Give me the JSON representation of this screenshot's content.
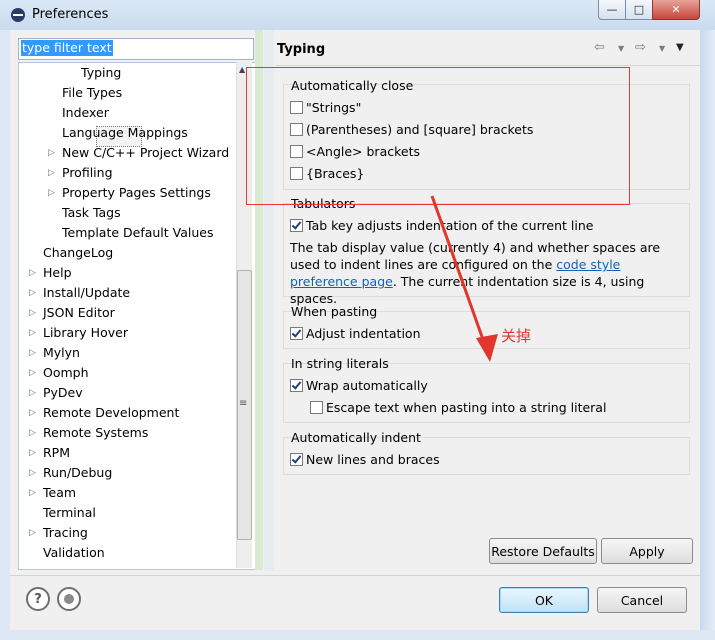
{
  "window": {
    "title": "Preferences",
    "min_glyph": "—",
    "max_glyph": "□",
    "close_glyph": "✕"
  },
  "filter": {
    "text": "type filter text"
  },
  "tree": {
    "items": [
      {
        "label": "Typing",
        "expandable": false,
        "selected": true
      },
      {
        "label": "File Types",
        "expandable": false
      },
      {
        "label": "Indexer",
        "expandable": false
      },
      {
        "label": "Language Mappings",
        "expandable": false
      },
      {
        "label": "New C/C++ Project Wizard",
        "expandable": true
      },
      {
        "label": "Profiling",
        "expandable": true
      },
      {
        "label": "Property Pages Settings",
        "expandable": true
      },
      {
        "label": "Task Tags",
        "expandable": false
      },
      {
        "label": "Template Default Values",
        "expandable": false
      },
      {
        "label": "ChangeLog",
        "expandable": false
      },
      {
        "label": "Help",
        "expandable": true
      },
      {
        "label": "Install/Update",
        "expandable": true
      },
      {
        "label": "JSON Editor",
        "expandable": true
      },
      {
        "label": "Library Hover",
        "expandable": true
      },
      {
        "label": "Mylyn",
        "expandable": true
      },
      {
        "label": "Oomph",
        "expandable": true
      },
      {
        "label": "PyDev",
        "expandable": true
      },
      {
        "label": "Remote Development",
        "expandable": true
      },
      {
        "label": "Remote Systems",
        "expandable": true
      },
      {
        "label": "RPM",
        "expandable": true
      },
      {
        "label": "Run/Debug",
        "expandable": true
      },
      {
        "label": "Team",
        "expandable": true
      },
      {
        "label": "Terminal",
        "expandable": false
      },
      {
        "label": "Tracing",
        "expandable": true
      },
      {
        "label": "Validation",
        "expandable": false
      }
    ]
  },
  "page": {
    "title": "Typing",
    "nav": {
      "back_icon": "⇦",
      "forward_icon": "⇨",
      "menu_icon": "▼"
    },
    "automatically_close": {
      "label": "Automatically close",
      "options": [
        {
          "label": "\"Strings\"",
          "checked": false
        },
        {
          "label": "(Parentheses) and [square] brackets",
          "checked": false
        },
        {
          "label": "<Angle> brackets",
          "checked": false
        },
        {
          "label": "{Braces}",
          "checked": false
        }
      ]
    },
    "tabulators": {
      "label": "Tabulators",
      "option": {
        "label": "Tab key adjusts indentation of the current line",
        "checked": true
      },
      "desc_before": "The tab display value (currently 4) and whether spaces are used to indent lines are configured on the ",
      "desc_link": "code style preference page",
      "desc_after": ". The current indentation size is 4, using spaces."
    },
    "when_pasting": {
      "label": "When pasting",
      "option": {
        "label": "Adjust indentation",
        "checked": true
      }
    },
    "string_literals": {
      "label": "In string literals",
      "wrap": {
        "label": "Wrap automatically",
        "checked": true
      },
      "escape": {
        "label": "Escape text when pasting into a string literal",
        "checked": false
      }
    },
    "auto_indent": {
      "label": "Automatically indent",
      "option": {
        "label": "New lines and braces",
        "checked": true
      }
    },
    "restore_defaults": "Restore Defaults",
    "apply": "Apply"
  },
  "footer": {
    "ok": "OK",
    "cancel": "Cancel",
    "help_glyph": "?"
  },
  "annotation": {
    "text": "关掉",
    "color": "#e2362d"
  }
}
